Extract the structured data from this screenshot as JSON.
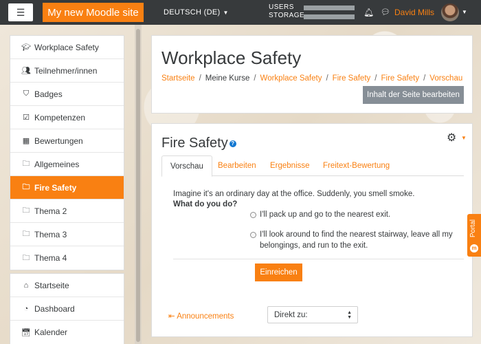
{
  "navbar": {
    "site_name": "My new Moodle site",
    "language": "DEUTSCH (DE)",
    "users_label": "USERS",
    "storage_label": "STORAGE",
    "user_name": "David Mills"
  },
  "sidebar": {
    "group1": [
      {
        "label": "Workplace Safety",
        "icon": "graduation-cap-icon"
      },
      {
        "label": "Teilnehmer/innen",
        "icon": "users-icon"
      },
      {
        "label": "Badges",
        "icon": "shield-icon"
      },
      {
        "label": "Kompetenzen",
        "icon": "checkbox-icon"
      },
      {
        "label": "Bewertungen",
        "icon": "table-icon"
      },
      {
        "label": "Allgemeines",
        "icon": "folder-icon"
      },
      {
        "label": "Fire Safety",
        "icon": "folder-icon",
        "active": true
      },
      {
        "label": "Thema 2",
        "icon": "folder-icon"
      },
      {
        "label": "Thema 3",
        "icon": "folder-icon"
      },
      {
        "label": "Thema 4",
        "icon": "folder-icon"
      }
    ],
    "group2": [
      {
        "label": "Startseite",
        "icon": "home-icon"
      },
      {
        "label": "Dashboard",
        "icon": "dashboard-icon"
      },
      {
        "label": "Kalender",
        "icon": "calendar-icon"
      }
    ]
  },
  "header": {
    "title": "Workplace Safety",
    "breadcrumb": [
      "Startseite",
      "Meine Kurse",
      "Workplace Safety",
      "Fire Safety",
      "Fire Safety",
      "Vorschau"
    ],
    "edit_button": "Inhalt der Seite bearbeiten"
  },
  "main": {
    "title": "Fire Safety",
    "tabs": [
      "Vorschau",
      "Bearbeiten",
      "Ergebnisse",
      "Freitext-Bewertung"
    ],
    "question_text": "Imagine it's an ordinary day at the office. Suddenly, you smell smoke.",
    "question_prompt": "What do you do?",
    "option_1": "I'll pack up and go to the nearest exit.",
    "option_2_line1": "I'll look around to find the nearest stairway, leave all my",
    "option_2_line2": "belongings, and run to the exit.",
    "submit_button": "Einreichen",
    "announcements_link": "Announcements",
    "jump_select": "Direkt zu:"
  },
  "portal_tab": {
    "label": "Portal"
  },
  "colors": {
    "accent": "#f98012",
    "navbar": "#373a3c",
    "secondary_button": "#868e96",
    "help": "#1177d1"
  }
}
